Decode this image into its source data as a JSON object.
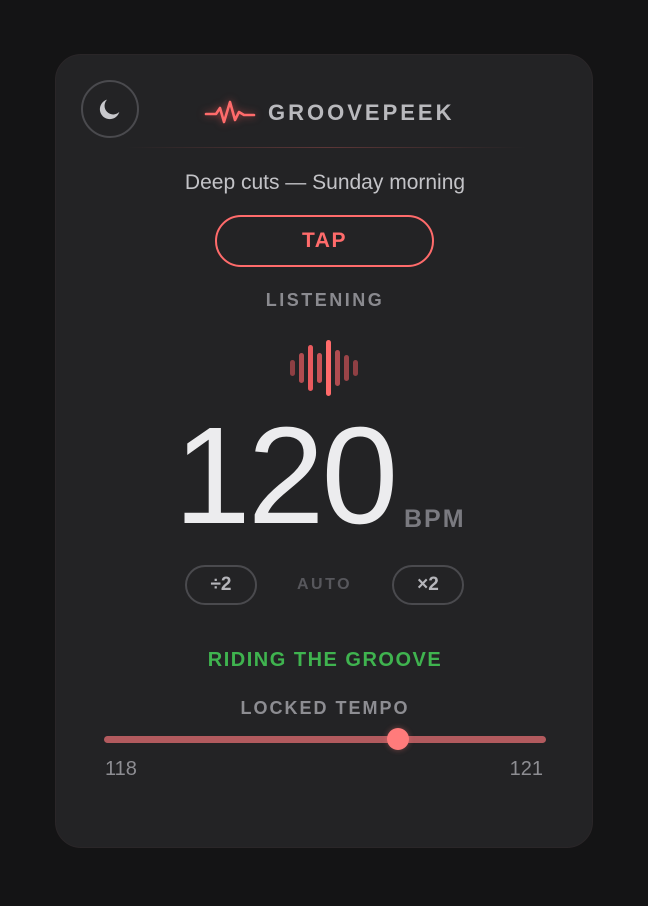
{
  "app": {
    "name": "GROOVEPEEK",
    "brand_icon": "heartbeat-pulse-icon",
    "theme_icon": "moon-icon"
  },
  "session": {
    "title": "Deep cuts — Sunday morning"
  },
  "tap_button": {
    "label": "TAP"
  },
  "status": {
    "label": "LISTENING"
  },
  "tempo": {
    "value": "120",
    "unit": "BPM"
  },
  "multiplier": {
    "half_label": "÷2",
    "auto_label": "AUTO",
    "double_label": "×2"
  },
  "groove_message": "RIDING THE GROOVE",
  "locked_tempo": {
    "label": "LOCKED TEMPO",
    "min": 118,
    "max": 121,
    "min_label": "118",
    "max_label": "121",
    "position_fraction": 0.665
  },
  "colors": {
    "accent": "#ff6b6b",
    "success": "#3fb34f",
    "background": "#141415",
    "card": "#232325"
  }
}
